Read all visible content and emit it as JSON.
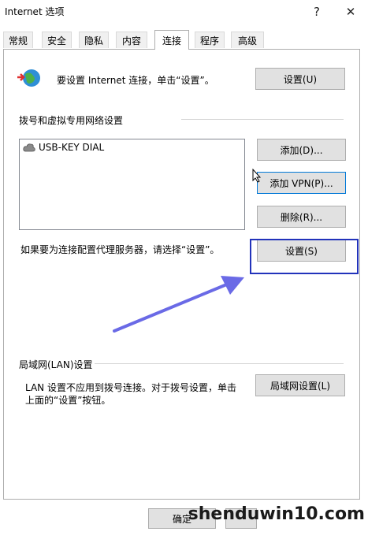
{
  "window": {
    "title": "Internet 选项",
    "help_glyph": "?",
    "close_glyph": "✕"
  },
  "tabs": [
    {
      "label": "常规"
    },
    {
      "label": "安全"
    },
    {
      "label": "隐私"
    },
    {
      "label": "内容"
    },
    {
      "label": "连接"
    },
    {
      "label": "程序"
    },
    {
      "label": "高级"
    }
  ],
  "setup": {
    "text": "要设置 Internet 连接，单击“设置”。",
    "button": "设置(U)"
  },
  "dialup": {
    "heading": "拨号和虚拟专用网络设置",
    "entries": [
      "USB-KEY DIAL"
    ],
    "add_button": "添加(D)...",
    "add_vpn_button": "添加 VPN(P)...",
    "remove_button": "删除(R)...",
    "proxy_text": "如果要为连接配置代理服务器，请选择“设置”。",
    "settings_button": "设置(S)"
  },
  "lan": {
    "heading": "局域网(LAN)设置",
    "text_line1": "LAN 设置不应用到拨号连接。对于拨号设置，单击",
    "text_line2": "上面的“设置”按钮。",
    "button": "局域网设置(L)"
  },
  "footer": {
    "ok_button": "确定"
  },
  "watermark": {
    "text": "shenduwin10.com"
  },
  "colors": {
    "annotation_box": "#2233bb",
    "annotation_arrow": "#6a6ae6"
  }
}
